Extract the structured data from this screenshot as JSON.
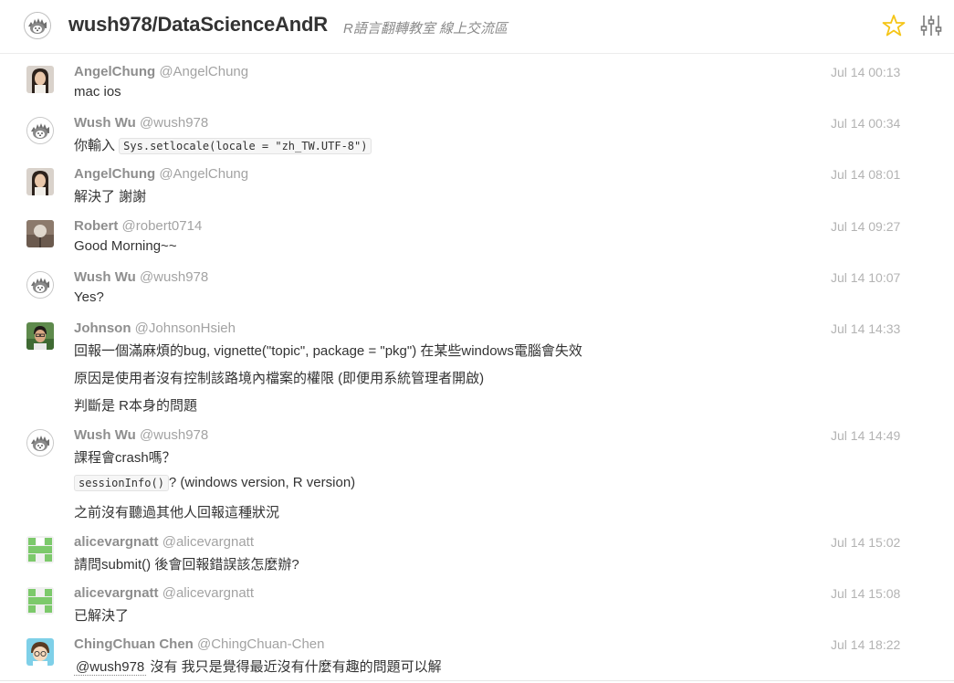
{
  "header": {
    "title": "wush978/DataScienceAndR",
    "topic": "R語言翻轉教室 線上交流區",
    "star_icon": "star-icon",
    "settings_icon": "settings-sliders-icon",
    "accent_color": "#f5c518"
  },
  "messages": [
    {
      "name": "AngelChung",
      "handle": "@AngelChung",
      "time": "Jul 14 00:13",
      "avatar": "angel",
      "lines": [
        "mac ios"
      ]
    },
    {
      "name": "Wush Wu",
      "handle": "@wush978",
      "time": "Jul 14 00:34",
      "avatar": "wush",
      "prefix": "你輸入 ",
      "code": "Sys.setlocale(locale = \"zh_TW.UTF-8\")"
    },
    {
      "name": "AngelChung",
      "handle": "@AngelChung",
      "time": "Jul 14 08:01",
      "avatar": "angel",
      "lines": [
        "解決了 謝謝"
      ]
    },
    {
      "name": "Robert",
      "handle": "@robert0714",
      "time": "Jul 14 09:27",
      "avatar": "robert",
      "lines": [
        "Good Morning~~"
      ]
    },
    {
      "name": "Wush Wu",
      "handle": "@wush978",
      "time": "Jul 14 10:07",
      "avatar": "wush",
      "lines": [
        "Yes?"
      ]
    },
    {
      "name": "Johnson",
      "handle": "@JohnsonHsieh",
      "time": "Jul 14 14:33",
      "avatar": "johnson",
      "lines": [
        "回報一個滿麻煩的bug, vignette(\"topic\", package = \"pkg\") 在某些windows電腦會失效",
        "原因是使用者沒有控制該路境內檔案的權限 (即便用系統管理者開啟)",
        "判斷是 R本身的問題"
      ]
    },
    {
      "name": "Wush Wu",
      "handle": "@wush978",
      "time": "Jul 14 14:49",
      "avatar": "wush",
      "lines": [
        "課程會crash嗎？",
        "之前沒有聽過其他人回報這種狀況"
      ],
      "code": "sessionInfo()",
      "code_suffix": "? (windows version, R version)"
    },
    {
      "name": "alicevargnatt",
      "handle": "@alicevargnatt",
      "time": "Jul 14 15:02",
      "avatar": "alice",
      "lines": [
        "請問submit() 後會回報錯誤該怎麼辦?"
      ]
    },
    {
      "name": "alicevargnatt",
      "handle": "@alicevargnatt",
      "time": "Jul 14 15:08",
      "avatar": "alice",
      "lines": [
        "已解決了"
      ]
    },
    {
      "name": "ChingChuan Chen",
      "handle": "@ChingChuan-Chen",
      "time": "Jul 14 18:22",
      "avatar": "chingchuan",
      "mention": "@wush978",
      "text_after_mention": " 沒有 我只是覺得最近沒有什麼有趣的問題可以解"
    }
  ]
}
